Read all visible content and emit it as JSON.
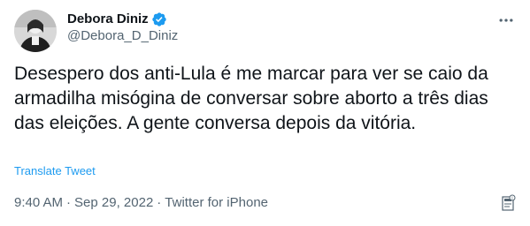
{
  "author": {
    "display_name": "Debora Diniz",
    "handle": "@Debora_D_Diniz",
    "verified": true
  },
  "tweet": {
    "text": "Desespero dos anti-Lula é me marcar para ver se caio da armadilha misógina de conversar sobre aborto a três dias das eleições. A gente conversa depois da vitória.",
    "translate_label": "Translate Tweet",
    "time": "9:40 AM",
    "separator": "·",
    "date": "Sep 29, 2022",
    "source": "Twitter for iPhone"
  },
  "colors": {
    "verified_badge": "#1d9bf0",
    "link": "#1d9bf0",
    "secondary_text": "#536471"
  },
  "icons": {
    "more": "more-options-icon",
    "verified": "verified-badge-icon",
    "info": "info-icon"
  }
}
